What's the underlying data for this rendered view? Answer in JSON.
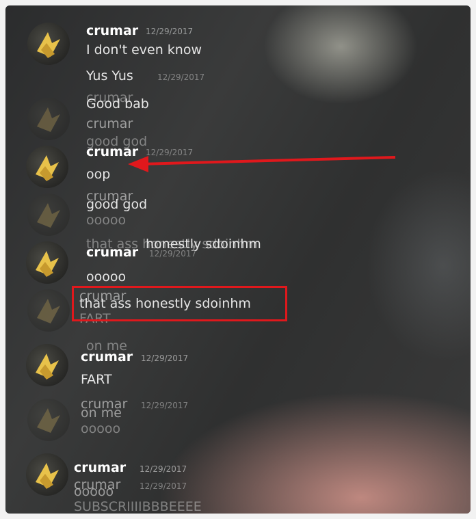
{
  "messages": [
    {
      "user": "crumar",
      "time": "12/29/2017",
      "text": "I don't even know"
    },
    {
      "text": "Yus Yus",
      "ghost_time": "12/29/2017"
    },
    {
      "user_ghost": "crumar",
      "text": "Good bab"
    },
    {
      "user_ghost": "crumar",
      "text": "good god"
    },
    {
      "user": "crumar",
      "time": "12/29/2017",
      "text": "oop"
    },
    {
      "user_ghost": "crumar",
      "text": "good god",
      "ghost_text": "ooooo"
    },
    {
      "ghost_text": "that ass honestly sdoinhm",
      "text": "honestly sdoinhm"
    },
    {
      "user": "crumar",
      "time": "12/29/2017",
      "text": "ooooo"
    },
    {
      "user_ghost": "crumar",
      "text": "that ass honestly sdoinhm",
      "ghost_text": "FART"
    },
    {
      "ghost_text": "on me"
    },
    {
      "user": "crumar",
      "time": "12/29/2017",
      "text": "FART"
    },
    {
      "user": "crumar",
      "time": "12/29/2017",
      "text": "on me",
      "ghost_text": "ooooo"
    },
    {
      "user": "crumar",
      "time": "12/29/2017",
      "text": "ooooo"
    },
    {
      "user_ghost": "crumar",
      "ghost_time": "12/29/2017"
    },
    {
      "text": "SUBSCRIIIIBBBEEEE"
    }
  ],
  "annotation": {
    "arrow_color": "#e0181c",
    "box_color": "#e0181c"
  }
}
